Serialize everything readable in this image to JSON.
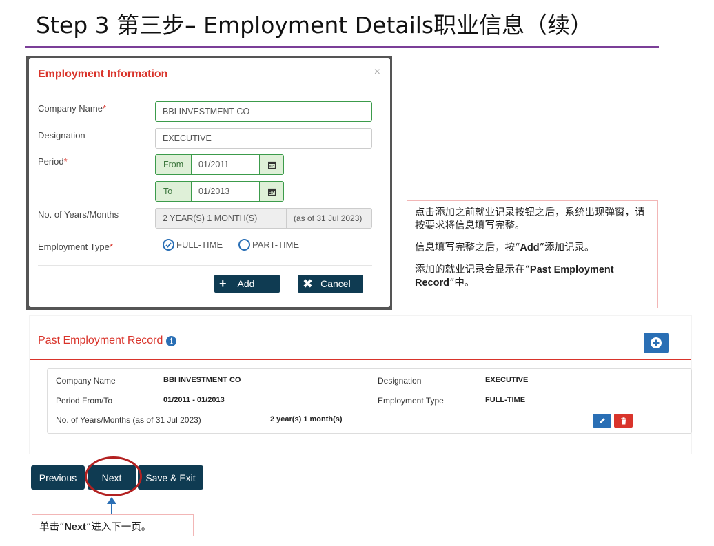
{
  "slide": {
    "title": "Step 3 第三步– Employment Details职业信息（续）",
    "accent_color": "#7b3f98"
  },
  "modal": {
    "title": "Employment Information",
    "close_glyph": "×",
    "company_label": "Company Name",
    "company_value": "BBI INVESTMENT CO",
    "designation_label": "Designation",
    "designation_value": "EXECUTIVE",
    "period_label": "Period",
    "from_label": "From",
    "from_value": "01/2011",
    "to_label": "To",
    "to_value": "01/2013",
    "years_label": "No. of Years/Months",
    "years_value": "2 YEAR(S) 1 MONTH(S)",
    "years_asof": "(as of 31 Jul 2023)",
    "emptype_label": "Employment Type",
    "required_mark": "*",
    "option_fulltime": "FULL-TIME",
    "option_parttime": "PART-TIME",
    "selected_option": "FULL-TIME",
    "add_label": "Add",
    "cancel_label": "Cancel",
    "icons": {
      "calendar": "calendar-icon",
      "plus": "plus-icon",
      "times": "times-icon"
    }
  },
  "note": {
    "line1": "点击添加之前就业记录按钮之后，系统出现弹窗，请按要求将信息填写完整。",
    "line2_pre": "信息填写完整之后，按“",
    "line2_bold": "Add",
    "line2_post": "”添加记录。",
    "line3_pre": "添加的就业记录会显示在“",
    "line3_bold": "Past Employment Record",
    "line3_post": "”中。"
  },
  "past_record": {
    "title": "Past Employment Record",
    "info_glyph": "i",
    "company_label": "Company Name",
    "company_value": "BBI INVESTMENT CO",
    "designation_label": "Designation",
    "designation_value": "EXECUTIVE",
    "period_label": "Period From/To",
    "period_value": "01/2011 - 01/2013",
    "emptype_label": "Employment Type",
    "emptype_value": "FULL-TIME",
    "years_label": "No. of Years/Months (as of 31 Jul 2023)",
    "years_value": "2 year(s) 1 month(s)"
  },
  "nav": {
    "previous_label": "Previous",
    "next_label": "Next",
    "save_exit_label": "Save & Exit"
  },
  "tip": {
    "pre": "单击“",
    "bold": "Next",
    "post": "”进入下一页。"
  },
  "colors": {
    "brand_dark": "#0f3b52",
    "danger_red": "#d9342b",
    "primary_blue": "#2a6fb5",
    "success_green": "#3c9b4b"
  }
}
